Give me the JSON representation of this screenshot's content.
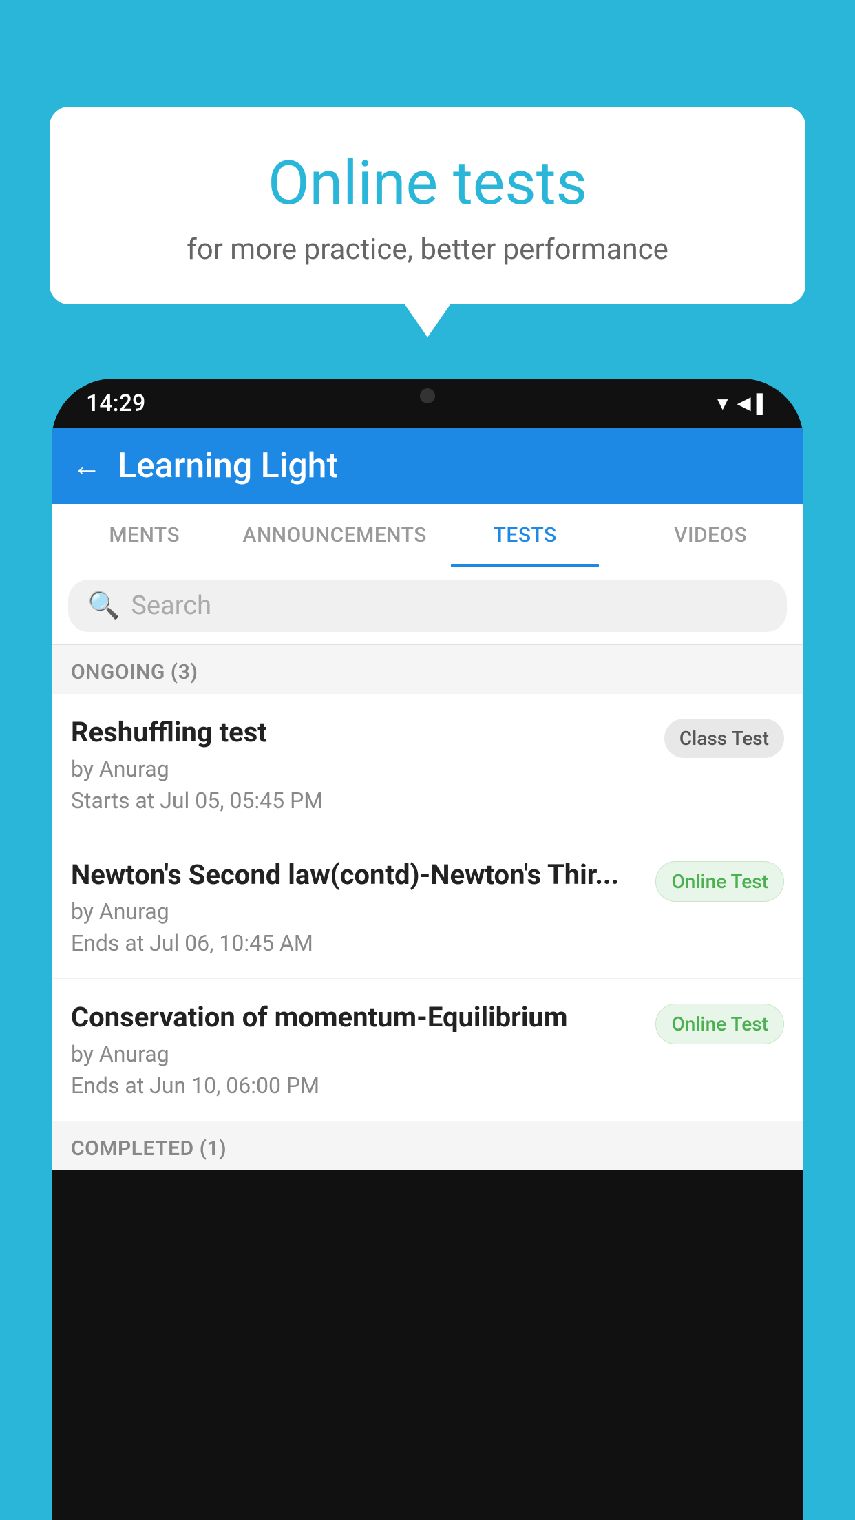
{
  "background_color": "#29b6d8",
  "speech_bubble": {
    "title": "Online tests",
    "subtitle": "for more practice, better performance"
  },
  "phone": {
    "status_bar": {
      "time": "14:29",
      "icons": [
        "wifi",
        "signal",
        "battery"
      ]
    },
    "app_bar": {
      "title": "Learning Light",
      "back_label": "←"
    },
    "tabs": [
      {
        "label": "MENTS",
        "active": false
      },
      {
        "label": "ANNOUNCEMENTS",
        "active": false
      },
      {
        "label": "TESTS",
        "active": true
      },
      {
        "label": "VIDEOS",
        "active": false
      }
    ],
    "search": {
      "placeholder": "Search"
    },
    "ongoing_section": {
      "label": "ONGOING (3)"
    },
    "test_items": [
      {
        "name": "Reshuffling test",
        "by": "by Anurag",
        "time_label": "Starts at",
        "time": "Jul 05, 05:45 PM",
        "badge_text": "Class Test",
        "badge_type": "class"
      },
      {
        "name": "Newton's Second law(contd)-Newton's Thir...",
        "by": "by Anurag",
        "time_label": "Ends at",
        "time": "Jul 06, 10:45 AM",
        "badge_text": "Online Test",
        "badge_type": "online"
      },
      {
        "name": "Conservation of momentum-Equilibrium",
        "by": "by Anurag",
        "time_label": "Ends at",
        "time": "Jun 10, 06:00 PM",
        "badge_text": "Online Test",
        "badge_type": "online"
      }
    ],
    "completed_section": {
      "label": "COMPLETED (1)"
    }
  }
}
